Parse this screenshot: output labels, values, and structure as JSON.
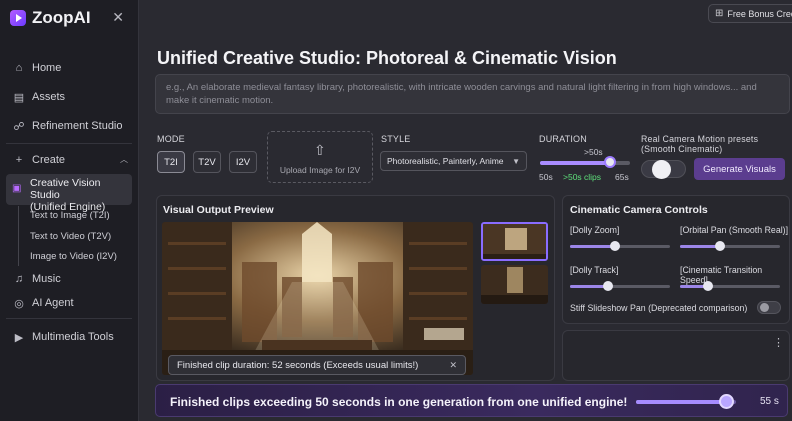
{
  "app": {
    "name": "ZoopAI",
    "credit_badge": "Free Bonus Credi"
  },
  "sidebar": {
    "items": [
      {
        "label": "Home",
        "icon": "home-icon"
      },
      {
        "label": "Assets",
        "icon": "document-icon"
      },
      {
        "label": "Refinement Studio",
        "icon": "users-icon"
      },
      {
        "label": "Create",
        "icon": "plus-icon"
      },
      {
        "label": "Creative Vision Studio (Unified Engine)",
        "icon": "video-icon"
      },
      {
        "label": "Music",
        "icon": "music-icon"
      },
      {
        "label": "AI Agent",
        "icon": "globe-icon"
      },
      {
        "label": "Multimedia Tools",
        "icon": "media-icon"
      }
    ],
    "sub_items": [
      "Text to Image (T2I)",
      "Text to Video (T2V)",
      "Image to Video (I2V)"
    ],
    "active_line1": "Creative Vision Studio",
    "active_line2": "(Unified Engine)"
  },
  "main": {
    "title": "Unified Creative Studio: Photoreal & Cinematic Vision",
    "prompt_placeholder": "e.g., An elaborate medieval fantasy library, photorealistic, with intricate wooden carvings and natural light filtering in from high windows... and make it cinematic motion.",
    "mode": {
      "label": "MODE",
      "options": [
        "T2I",
        "T2V",
        "I2V"
      ],
      "selected": "T2I"
    },
    "upload_label": "Upload Image for I2V",
    "style": {
      "label": "STYLE",
      "value": "Photorealistic, Painterly, Anime"
    },
    "duration": {
      "label": "DURATION",
      "value_label": ">50s",
      "min_label": "50s",
      "max_label": "65s",
      "clips_label": ">50s clips",
      "level": 0.78
    },
    "camera_motion_label": "Real Camera Motion presets (Smooth Cinematic)",
    "generate_button": "Generate Visuals"
  },
  "preview": {
    "title": "Visual Output Preview",
    "toast": "Finished clip duration: 52 seconds (Exceeds usual limits!)"
  },
  "camera_controls": {
    "title": "Cinematic Camera Controls",
    "sliders": [
      {
        "label": "[Dolly Zoom]",
        "level": 0.45
      },
      {
        "label": "[Orbital Pan (Smooth Real)]",
        "level": 0.4
      },
      {
        "label": "[Dolly Track]",
        "level": 0.38
      },
      {
        "label": "[Cinematic Transition Speed]",
        "level": 0.28
      }
    ],
    "toggle_label": "Stiff Slideshow Pan (Deprecated comparison)"
  },
  "banner": {
    "text": "Finished clips exceeding 50 seconds in one generation from one unified engine!",
    "value": "55 s",
    "level": 0.9
  }
}
